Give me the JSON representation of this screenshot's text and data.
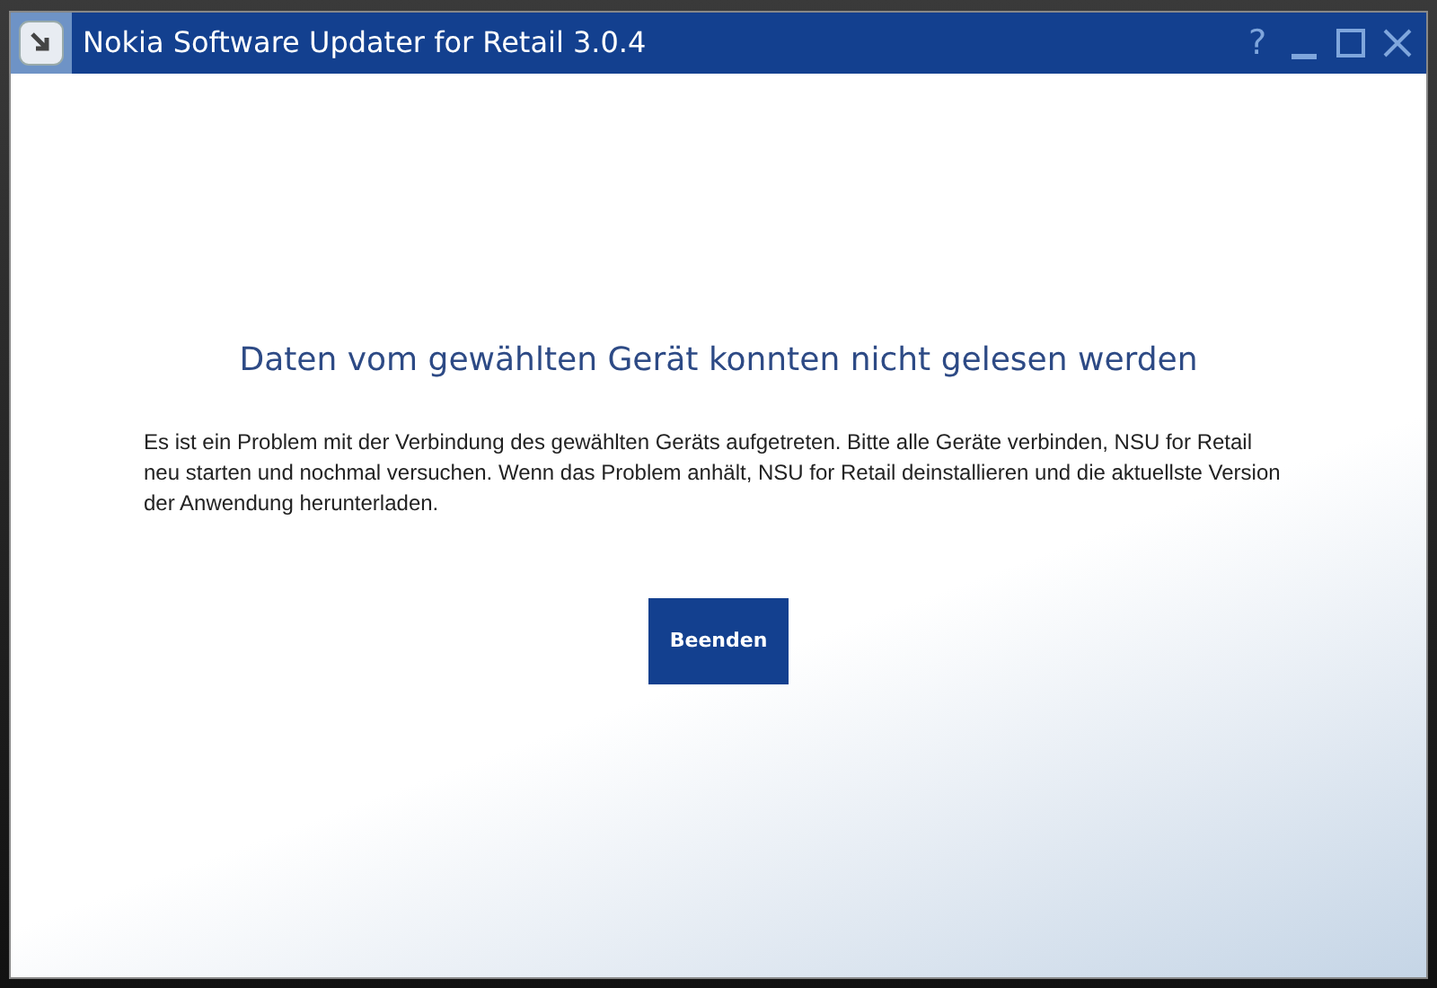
{
  "window": {
    "title": "Nokia Software Updater for Retail 3.0.4",
    "controls": [
      "?"
    ]
  },
  "dialog": {
    "heading": "Daten vom gewählten Gerät konnten nicht gelesen werden",
    "message": "Es ist ein Problem mit der Verbindung des gewählten Geräts aufgetreten. Bitte alle Geräte verbinden, NSU for Retail neu starten und nochmal versuchen. Wenn das Problem anhält, NSU for Retail deinstallieren und die aktuellste Version der Anwendung herunterladen.",
    "buttons": [
      "Beenden"
    ]
  }
}
